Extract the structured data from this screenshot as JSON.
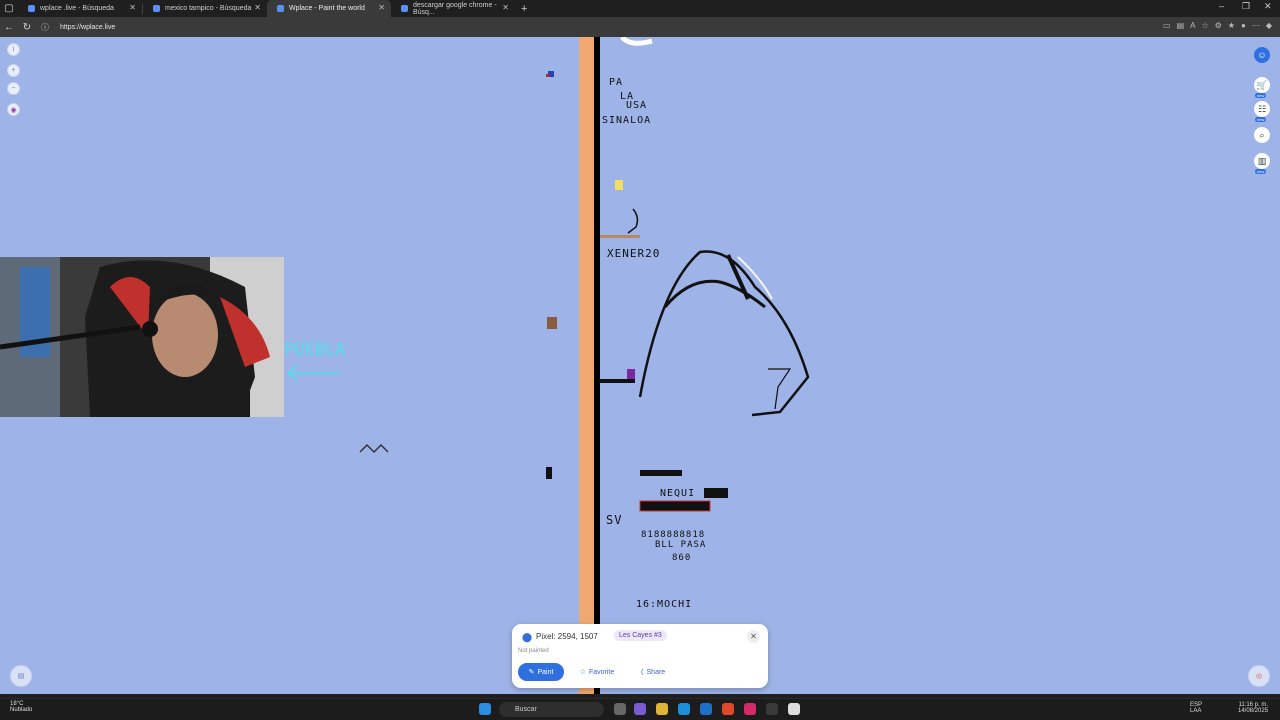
{
  "browser": {
    "tabs": [
      {
        "label": "wplace .live - Búsqueda"
      },
      {
        "label": "mexico tampico - Búsqueda"
      },
      {
        "label": "Wplace - Paint the world"
      },
      {
        "label": "descargar google chrome - Búsq..."
      }
    ],
    "url": "https://wplace.live"
  },
  "map": {
    "texts": {
      "pa": "PA",
      "la": "LA",
      "usa": "USA",
      "sinaloa": "SINALOA",
      "xener": "XENER20",
      "puebla": "PUEBLA",
      "nequi": "NEQUI",
      "sv": "SV",
      "account": "8188888818",
      "bll": "BLL PASA",
      "num": "860",
      "mochi": "16:MOCHI"
    }
  },
  "pixel_panel": {
    "pixel_label": "Pixel: 2594, 1507",
    "region": "Les Cayes #3",
    "status": "Not painted",
    "paint": "Paint",
    "favorite": "Favorite",
    "share": "Share"
  },
  "taskbar": {
    "temp": "18°C",
    "weather": "Nublado",
    "search": "Buscar",
    "lang1": "ESP",
    "lang2": "LAA",
    "time": "11:16 p. m.",
    "date": "14/08/2025"
  },
  "colors": {
    "map_background": "#9eb3e8",
    "stripe_orange": "#f0a870",
    "accent_blue": "#2f6fe0"
  }
}
